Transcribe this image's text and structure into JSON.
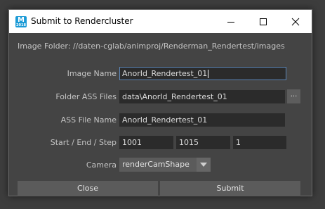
{
  "window": {
    "title": "Submit to Rendercluster",
    "app_icon_letter": "M",
    "app_icon_sub": "2018"
  },
  "image_folder": "Image Folder: //daten-cglab/animproj/Renderman_Rendertest/images",
  "form": {
    "image_name": {
      "label": "Image Name",
      "value": "AnorId_Rendertest_01"
    },
    "folder_ass": {
      "label": "Folder ASS Files",
      "value": "data\\AnorId_Rendertest_01",
      "browse_label": "..."
    },
    "ass_file": {
      "label": "ASS File Name",
      "value": "AnorId_Rendertest_01"
    },
    "frames": {
      "label": "Start / End / Step",
      "start": "1001",
      "end": "1015",
      "step": "1"
    },
    "camera": {
      "label": "Camera",
      "selected": "renderCamShape"
    }
  },
  "buttons": {
    "close": "Close",
    "submit": "Submit"
  },
  "colors": {
    "dialog_bg": "#444444",
    "field_bg": "#2b2b2b",
    "button_bg": "#5b5b5b",
    "focus_border": "#5c86b8",
    "label_text": "#c4c4c4"
  }
}
